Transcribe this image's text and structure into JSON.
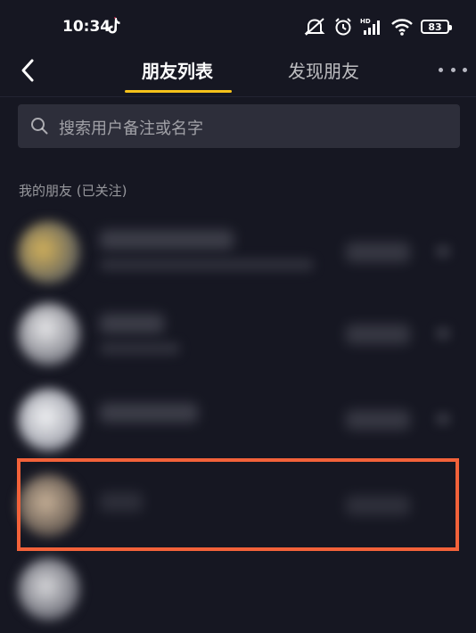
{
  "status_bar": {
    "time": "10:34",
    "battery": "83",
    "icons": [
      "tiktok-icon",
      "mute-icon",
      "alarm-icon",
      "hd-signal-icon",
      "wifi-icon",
      "battery-icon"
    ]
  },
  "nav": {
    "back_icon": "chevron-left-icon",
    "tabs": [
      {
        "label": "朋友列表",
        "active": true
      },
      {
        "label": "发现朋友",
        "active": false
      }
    ],
    "more_icon": "more-horizontal-icon",
    "accent_color": "#f5c21b"
  },
  "search": {
    "placeholder": "搜索用户备注或名字",
    "icon": "search-icon"
  },
  "section": {
    "title": "我的朋友 (已关注)"
  },
  "friends_note": "friend rows are blurred in the screenshot; names and avatars are not legible",
  "highlight": {
    "color": "#f3623a",
    "target_row_index": 3
  }
}
